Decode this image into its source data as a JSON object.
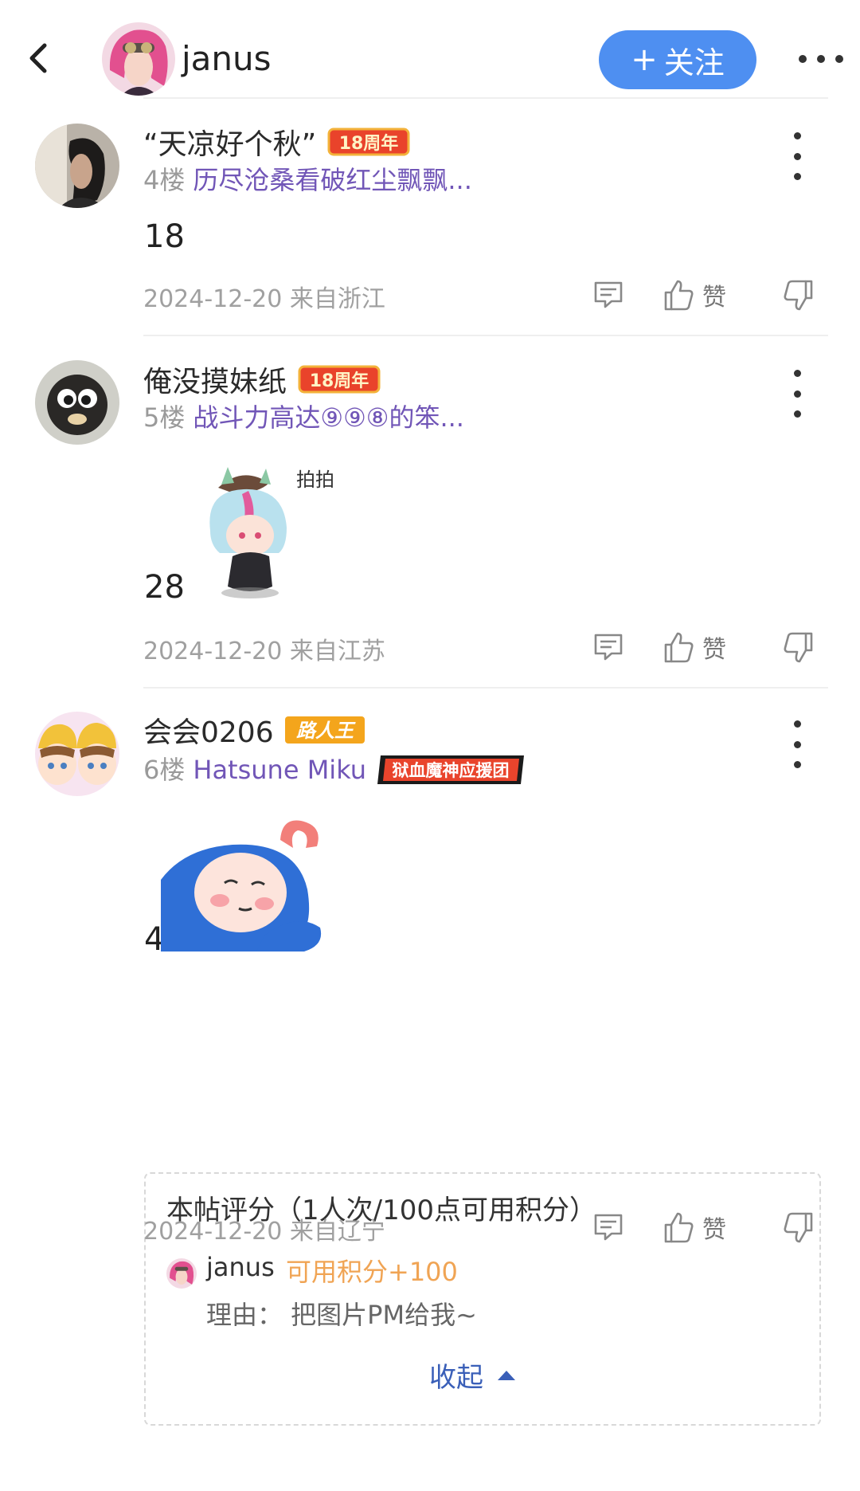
{
  "header": {
    "back_icon": "chevron-left-icon",
    "username": "janus",
    "follow_plus": "+",
    "follow_label": "关注",
    "more_icon": "more-horizontal-icon"
  },
  "posts": [
    {
      "username": "“天凉好个秋”",
      "badge": "18周年",
      "floor": "4楼",
      "floor_title": "历尽沧桑看破红尘飘飘...",
      "content": "18",
      "date": "2024-12-20 来自浙江",
      "like_label": "赞"
    },
    {
      "username": "俺没摸妹纸",
      "badge": "18周年",
      "floor": "5楼",
      "floor_title": "战斗力高达⑨⑨⑧的笨...",
      "content": "28",
      "sticker_text": "拍拍",
      "date": "2024-12-20 来自江苏",
      "like_label": "赞"
    },
    {
      "username": "会会0206",
      "badge": "路人王",
      "floor": "6楼",
      "floor_title": "Hatsune Miku",
      "group_badge": "狱血魔神应援团",
      "content": "4",
      "rating": {
        "title": "本帖评分（1人次/100点可用积分）",
        "rater_name": "janus",
        "score": "可用积分+100",
        "reason": "理由：  把图片PM给我~",
        "collapse_label": "收起"
      },
      "date": "2024-12-20 来自辽宁",
      "like_label": "赞"
    }
  ],
  "colors": {
    "accent": "#4e8ff1",
    "floor_title": "#7156b7",
    "score": "#f0a454",
    "collapse": "#3a5fb8"
  }
}
